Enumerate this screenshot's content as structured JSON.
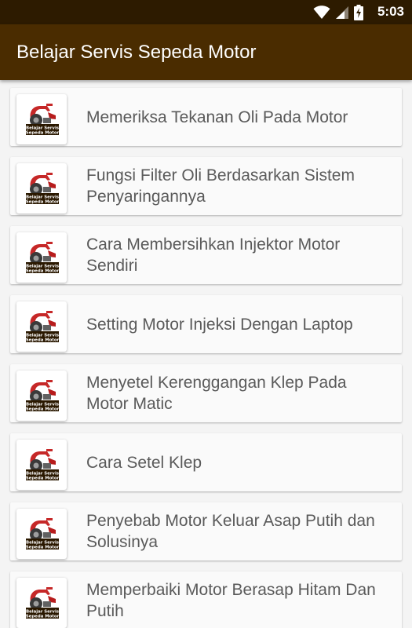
{
  "status_bar": {
    "time": "5:03",
    "icons": [
      "wifi-icon",
      "signal-icon",
      "battery-charging-icon"
    ],
    "background": "#2d1b00"
  },
  "app_bar": {
    "title": "Belajar Servis Sepeda Motor",
    "background": "#4a2c00"
  },
  "list": {
    "thumbnail_caption": [
      "Belajar Servis",
      "Sepeda Motor"
    ],
    "items": [
      {
        "label": "Memeriksa Tekanan Oli Pada Motor"
      },
      {
        "label": "Fungsi Filter Oli Berdasarkan Sistem Penyaringannya"
      },
      {
        "label": "Cara Membersihkan Injektor Motor Sendiri"
      },
      {
        "label": "Setting Motor Injeksi Dengan Laptop"
      },
      {
        "label": "Menyetel Kerenggangan Klep Pada Motor Matic"
      },
      {
        "label": "Cara Setel Klep"
      },
      {
        "label": "Penyebab Motor Keluar Asap Putih dan Solusinya"
      },
      {
        "label": "Memperbaiki Motor Berasap Hitam Dan Putih"
      }
    ]
  }
}
